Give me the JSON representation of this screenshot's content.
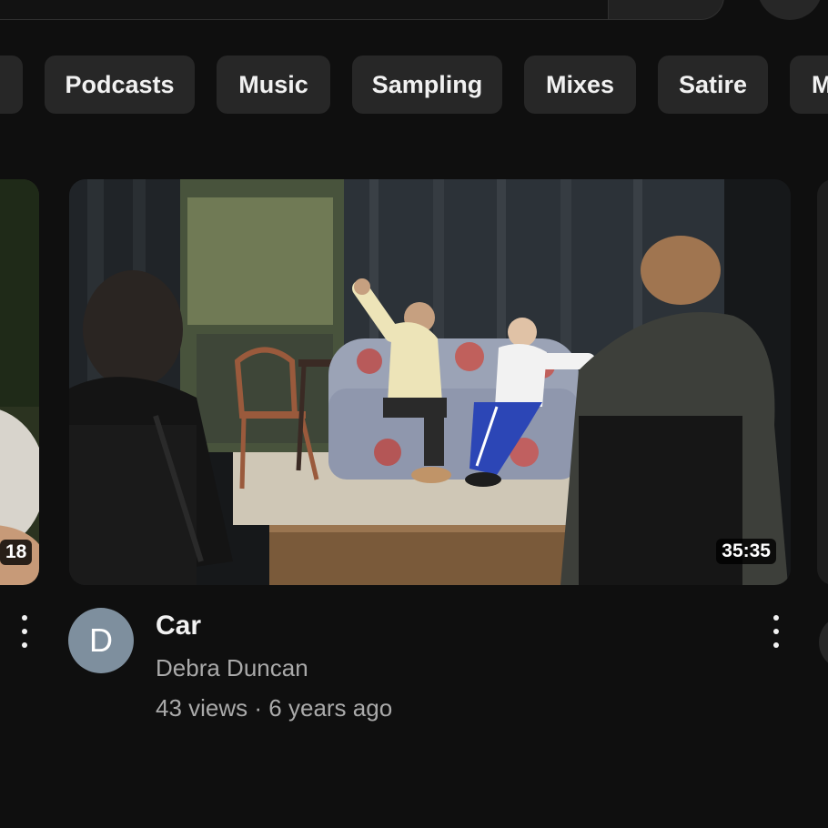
{
  "chips": [
    {
      "label": ""
    },
    {
      "label": "Podcasts"
    },
    {
      "label": "Music"
    },
    {
      "label": "Sampling"
    },
    {
      "label": "Mixes"
    },
    {
      "label": "Satire"
    },
    {
      "label": "M"
    }
  ],
  "left_video": {
    "duration_fragment": "18"
  },
  "video": {
    "title": "Car",
    "channel": "Debra Duncan",
    "avatar_letter": "D",
    "views": "43 views",
    "separator": "·",
    "age": "6 years ago",
    "duration": "35:35",
    "thumbnail_icon": "theater-stage-scene"
  },
  "colors": {
    "background": "#0f0f0f",
    "chip": "#272727",
    "avatar": "#7e8f9e",
    "secondary_text": "#aaaaaa"
  }
}
